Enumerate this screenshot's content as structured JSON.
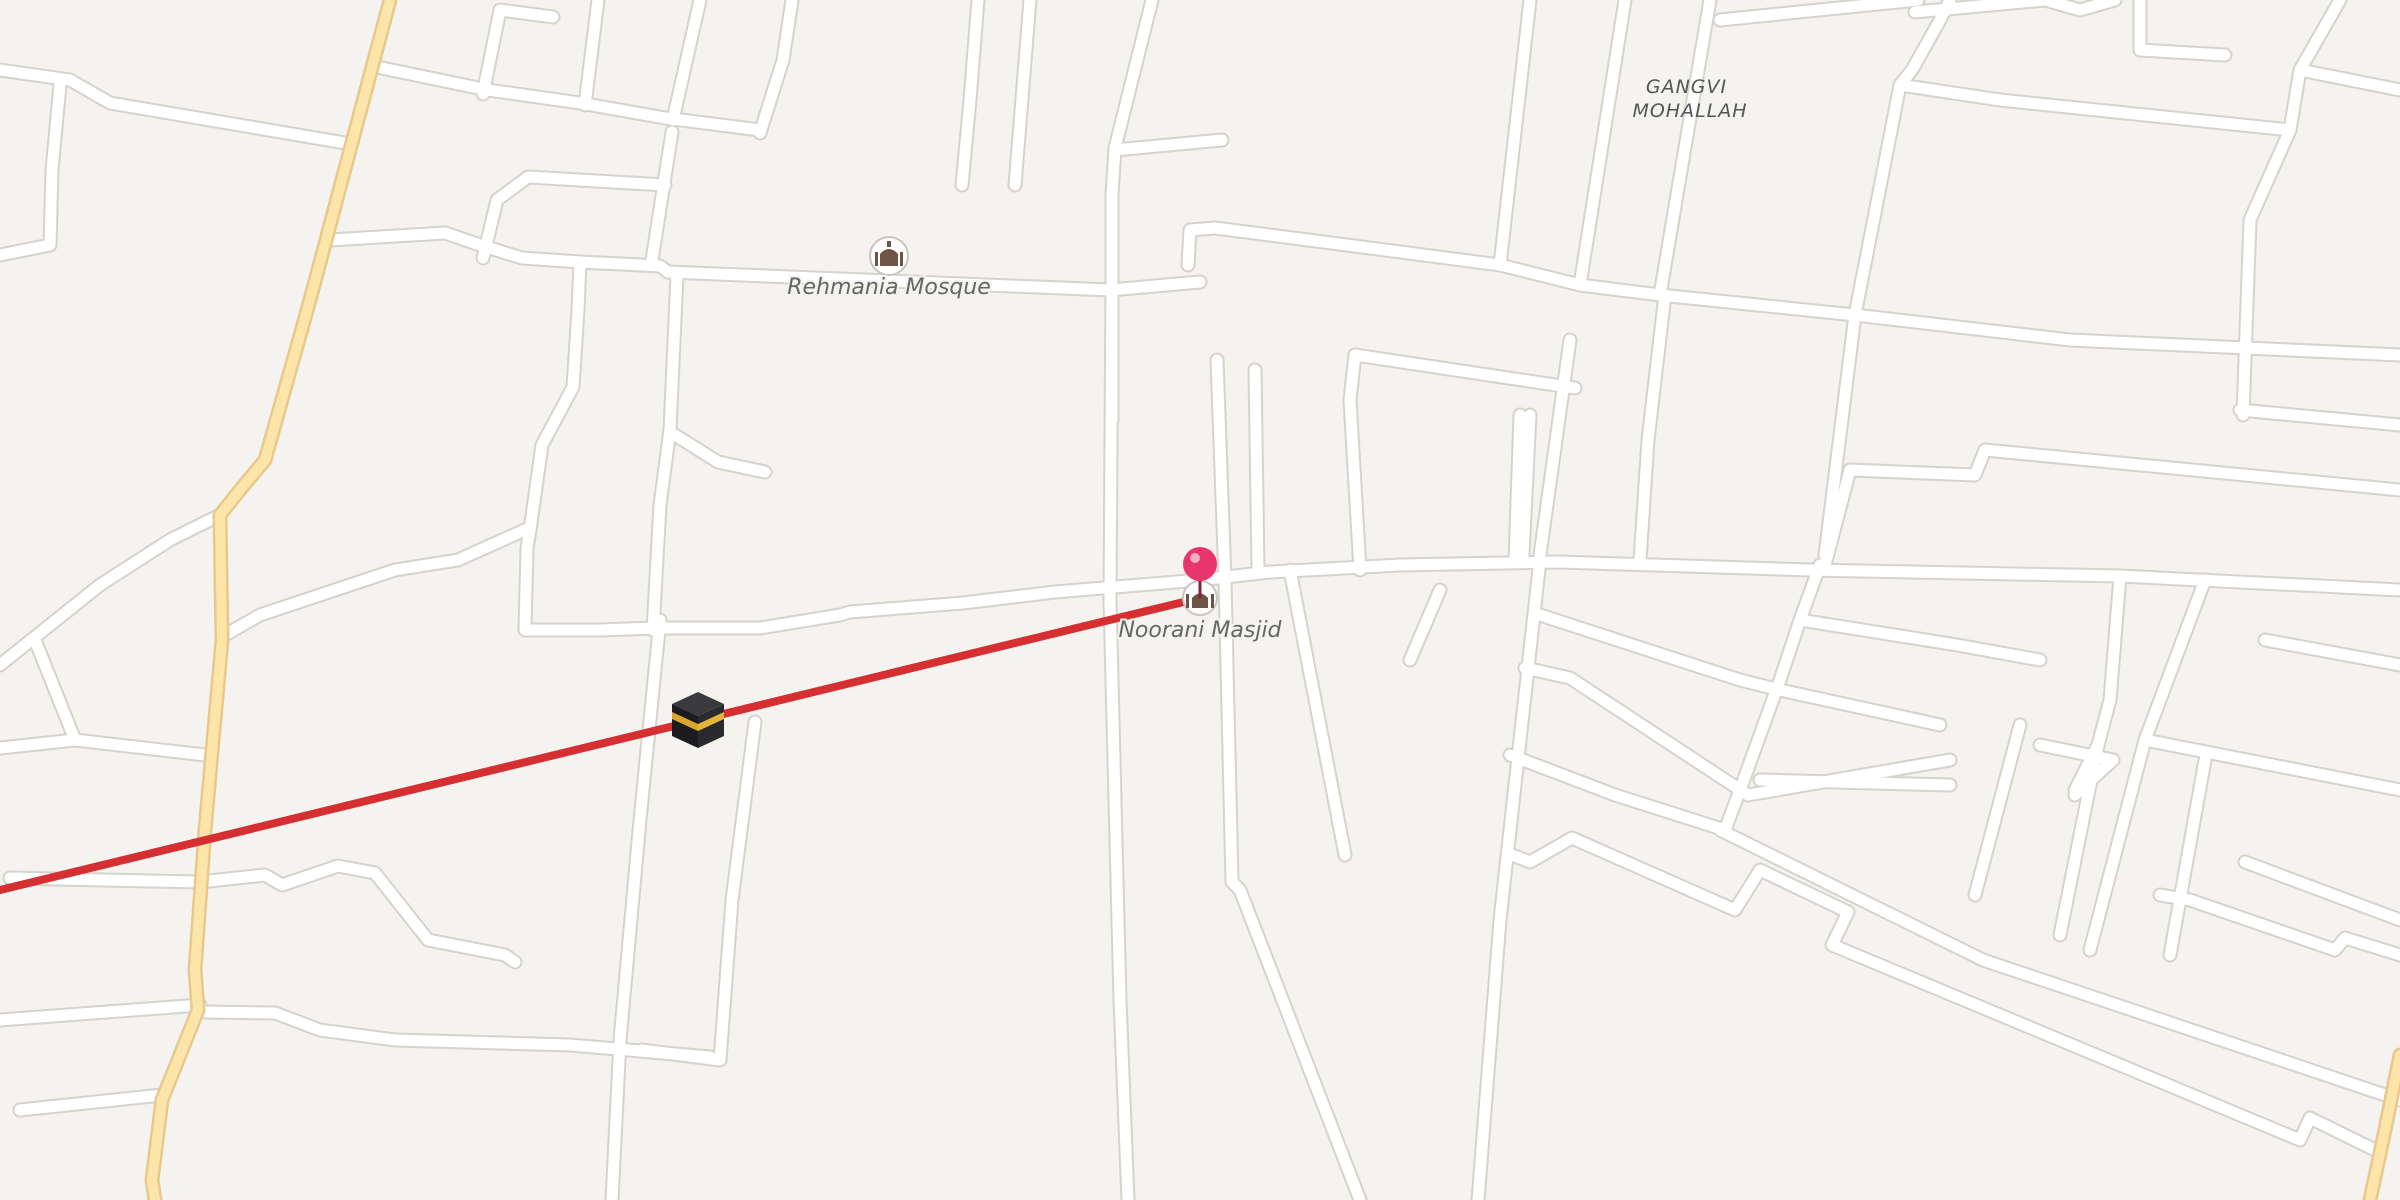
{
  "map": {
    "area_label": {
      "line1": "GANGVI",
      "line2": "MOHALLAH"
    },
    "pois": [
      {
        "name": "Rehmania Mosque",
        "icon": "mosque-icon"
      },
      {
        "name": "Noorani Masjid",
        "icon": "mosque-icon"
      }
    ],
    "markers": {
      "location_pin": {
        "icon": "location-pin-icon",
        "color": "#e8356d"
      },
      "kaaba": {
        "icon": "kaaba-icon"
      }
    },
    "qibla_line": {
      "color": "#d62f31"
    },
    "colors": {
      "background": "#f5f3f0",
      "road": "#ffffff",
      "road_casing": "#d6d2cc",
      "main_road": "#fde4a8",
      "main_road_casing": "#e7c98d"
    }
  }
}
